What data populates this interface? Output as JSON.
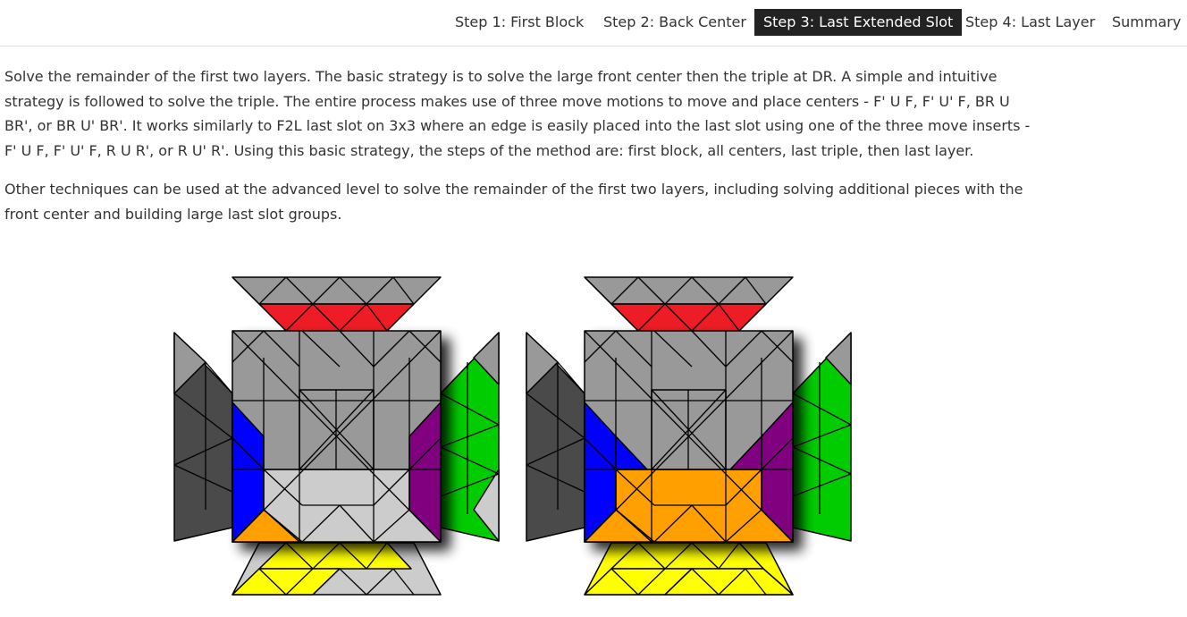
{
  "nav": {
    "tabs": [
      {
        "label": "Step 1: First Block",
        "active": false
      },
      {
        "label": "Step 2: Back Center",
        "active": false
      },
      {
        "label": "Step 3: Last Extended Slot",
        "active": true
      },
      {
        "label": "Step 4: Last Layer",
        "active": false
      },
      {
        "label": "Summary",
        "active": false
      }
    ]
  },
  "content": {
    "paragraphs": [
      "Solve the remainder of the first two layers. The basic strategy is to solve the large front center then the triple at DR. A simple and intuitive strategy is followed to solve the triple. The entire process makes use of three move motions to move and place centers - F' U F, F' U' F, BR U BR', or BR U' BR'. It works similarly to F2L last slot on 3x3 where an edge is easily placed into the last slot using one of the three move inserts - F' U F, F' U' F, R U R', or R U' R'. Using this basic strategy, the steps of the method are: first block, all centers, last triple, then last layer.",
      "Other techniques can be used at the advanced level to solve the remainder of the first two layers, including solving additional pieces with the front center and building large last slot groups."
    ]
  },
  "colors": {
    "red": "#ee1c24",
    "yellow": "#ffff00",
    "blue": "#0000ff",
    "green": "#00cc00",
    "purple": "#800080",
    "orange": "#ffa000",
    "gray": "#999999",
    "light_gray": "#cccccc",
    "dark_gray": "#4a4a4a"
  },
  "diagrams": [
    {
      "name": "before",
      "top_strip": [
        "gray",
        "red"
      ],
      "bottom_strip": [
        "yellow",
        "light_gray"
      ],
      "left_side": "dark_gray",
      "right_side": "green",
      "front_top": "gray",
      "front_bottom": "light_gray",
      "left_edge_piece": "blue",
      "right_edge_piece": "purple",
      "corner_piece": "orange"
    },
    {
      "name": "after",
      "top_strip": [
        "gray",
        "red"
      ],
      "bottom_strip": [
        "yellow",
        "yellow"
      ],
      "left_side": "dark_gray",
      "right_side": "green",
      "front_top": "gray",
      "front_bottom": "orange",
      "left_edge_piece": "blue",
      "right_edge_piece": "purple",
      "corner_piece": "orange"
    }
  ]
}
